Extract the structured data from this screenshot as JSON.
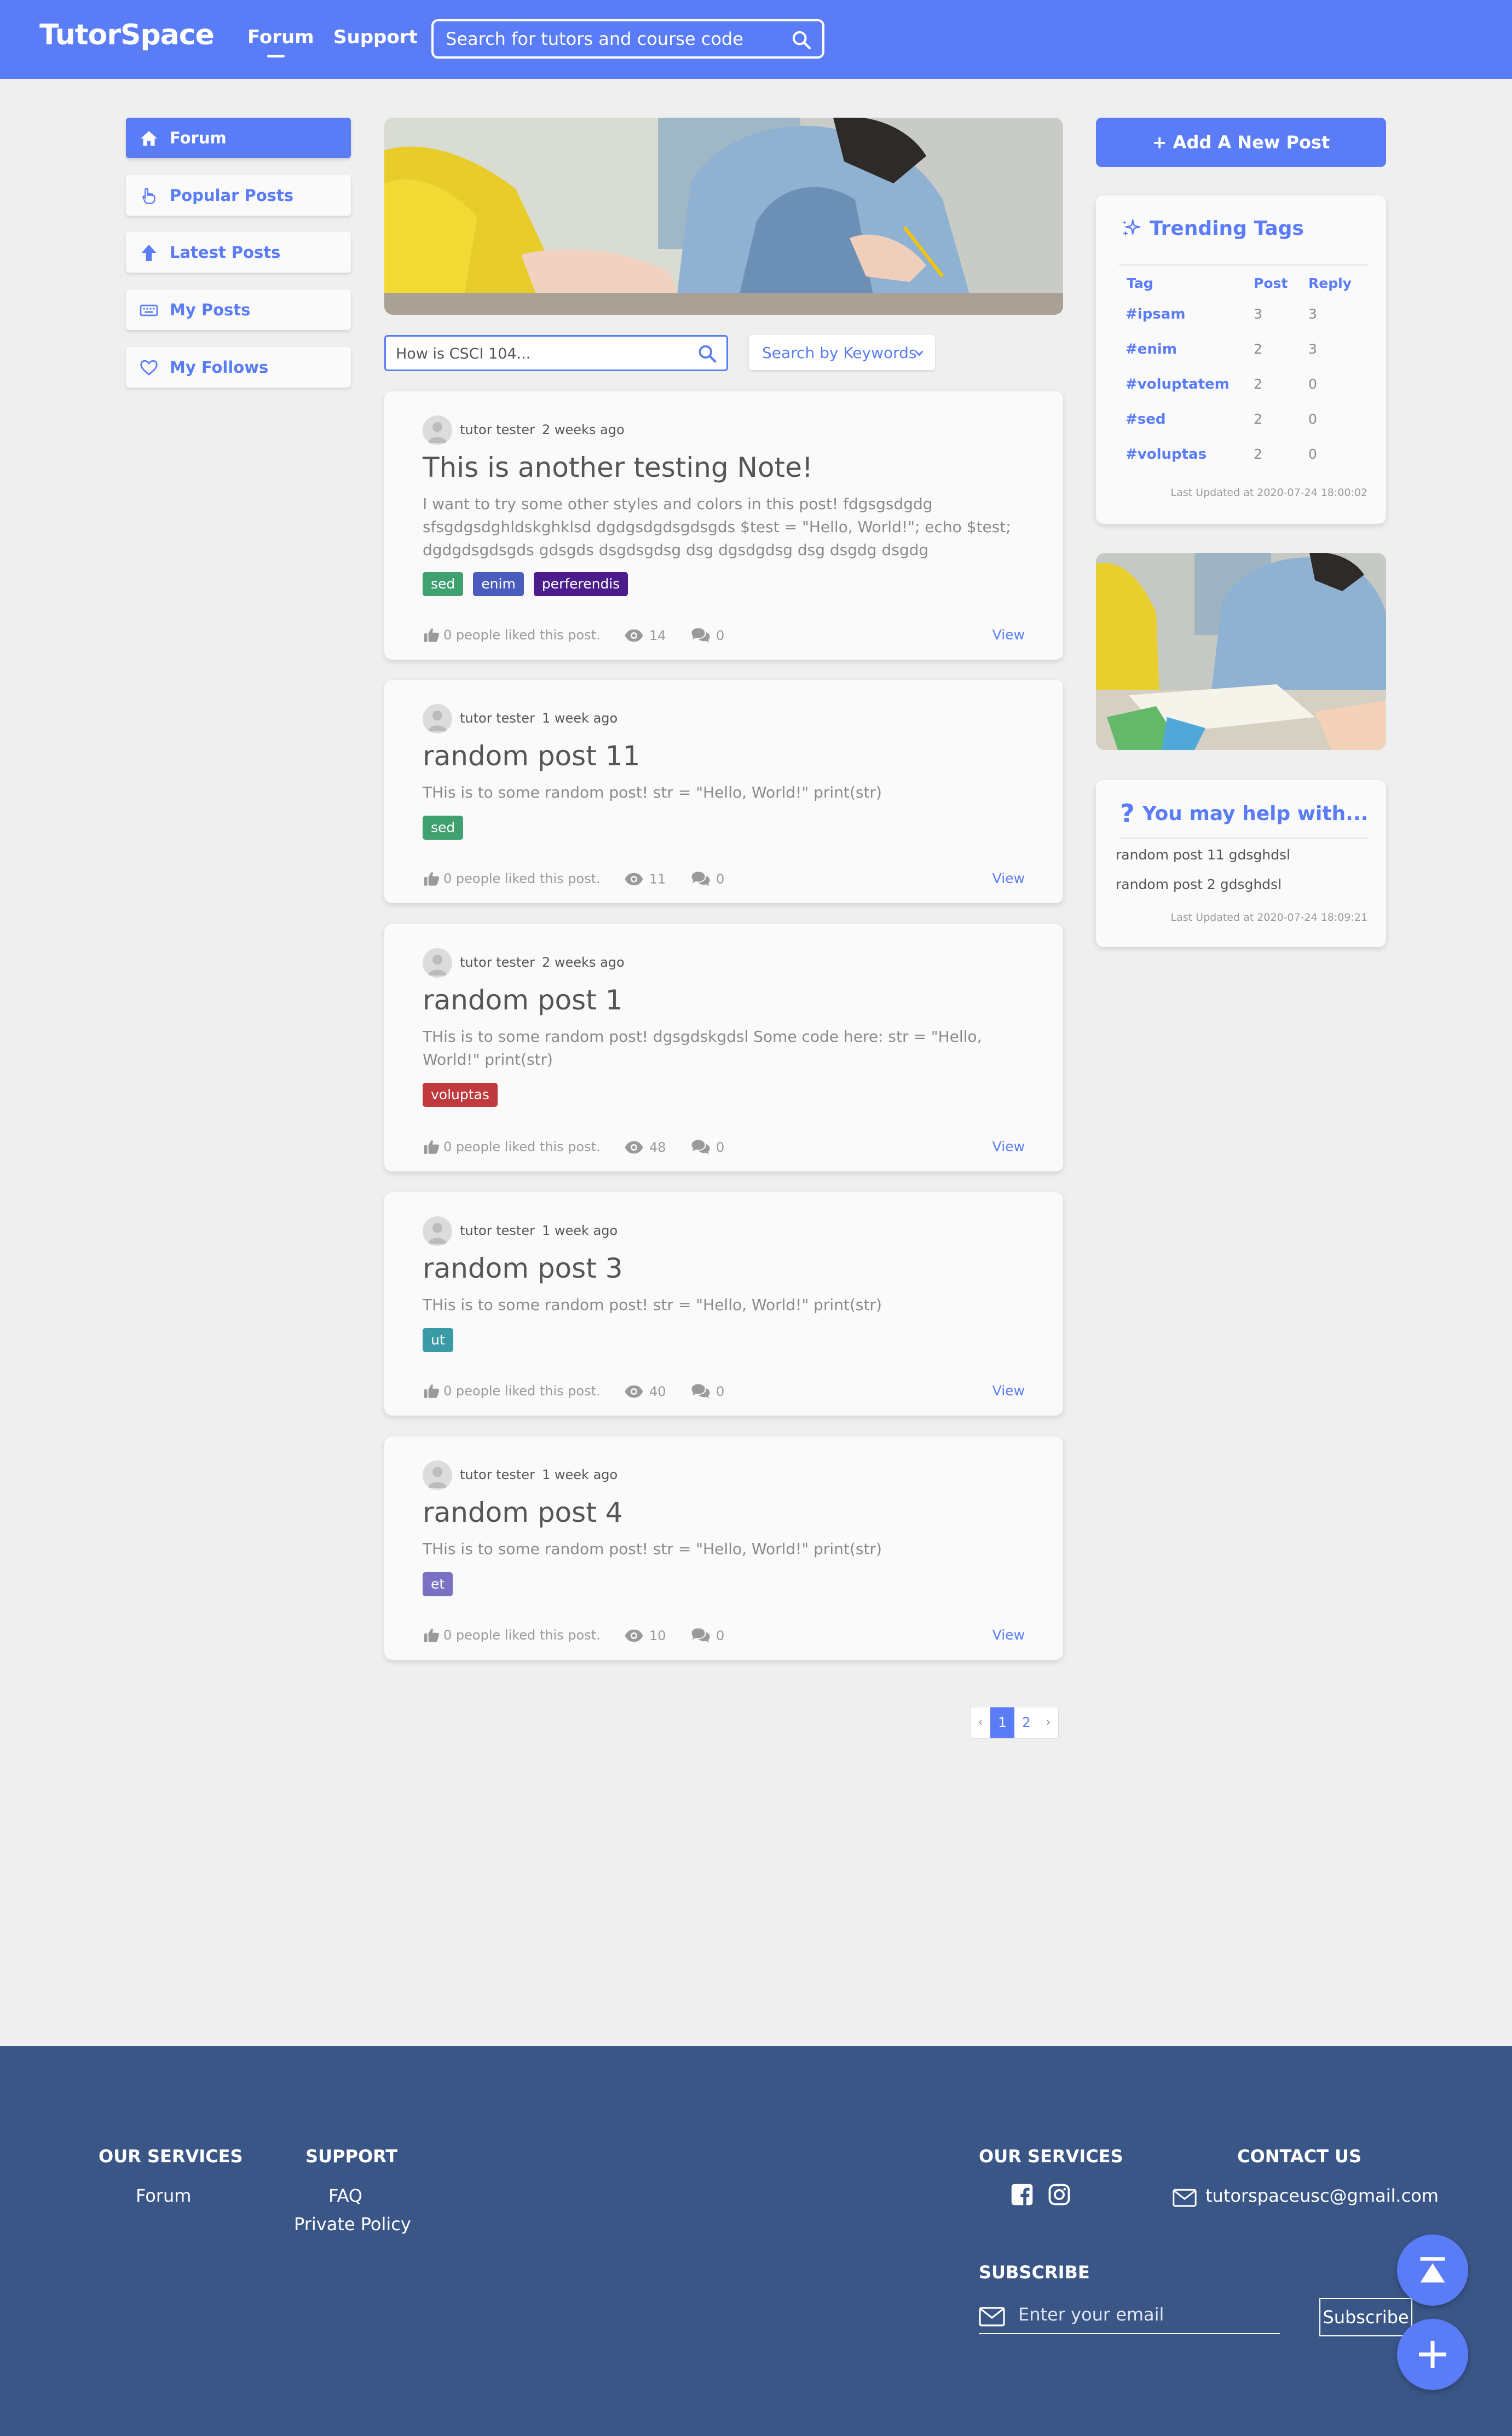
{
  "header": {
    "logo": "TutorSpace",
    "nav": [
      "Forum",
      "Support"
    ],
    "search_placeholder": "Search for tutors and course code"
  },
  "sidebar": {
    "items": [
      {
        "label": "Forum",
        "icon": "home-icon",
        "active": true
      },
      {
        "label": "Popular Posts",
        "icon": "hand-pointer-icon",
        "active": false
      },
      {
        "label": "Latest Posts",
        "icon": "arrow-up-icon",
        "active": false
      },
      {
        "label": "My Posts",
        "icon": "keyboard-icon",
        "active": false
      },
      {
        "label": "My Follows",
        "icon": "heart-icon",
        "active": false
      }
    ]
  },
  "feed": {
    "search_placeholder": "How is CSCI 104...",
    "filter_label": "Search by Keywords",
    "posts": [
      {
        "author": "tutor tester",
        "time": "2 weeks ago",
        "title": "This is another testing Note!",
        "body": "I want to try some other styles and colors in this post! fdgsgsdgdg sfsgdgsdghldskghklsd dgdgsdgdsgdsgds $test = \"Hello, World!\"; echo $test; dgdgdsgdsgds gdsgds dsgdsgdsg dsg dgsdgdsg dsg dsgdg dsgdg",
        "tags": [
          {
            "label": "sed",
            "color": "#3fa070"
          },
          {
            "label": "enim",
            "color": "#4b5cbf"
          },
          {
            "label": "perferendis",
            "color": "#4b1c8c"
          }
        ],
        "likes": "0 people liked this post.",
        "views": "14",
        "comments": "0",
        "view_label": "View"
      },
      {
        "author": "tutor tester",
        "time": "1 week ago",
        "title": "random post 11",
        "body": "THis is to some random post! str = \"Hello, World!\" print(str)",
        "tags": [
          {
            "label": "sed",
            "color": "#3fa070"
          }
        ],
        "likes": "0 people liked this post.",
        "views": "11",
        "comments": "0",
        "view_label": "View"
      },
      {
        "author": "tutor tester",
        "time": "2 weeks ago",
        "title": "random post 1",
        "body": "THis is to some random post! dgsgdskgdsl Some code here: str = \"Hello, World!\" print(str)",
        "tags": [
          {
            "label": "voluptas",
            "color": "#c0393d"
          }
        ],
        "likes": "0 people liked this post.",
        "views": "48",
        "comments": "0",
        "view_label": "View"
      },
      {
        "author": "tutor tester",
        "time": "1 week ago",
        "title": "random post 3",
        "body": "THis is to some random post! str = \"Hello, World!\" print(str)",
        "tags": [
          {
            "label": "ut",
            "color": "#3a9ba6"
          }
        ],
        "likes": "0 people liked this post.",
        "views": "40",
        "comments": "0",
        "view_label": "View"
      },
      {
        "author": "tutor tester",
        "time": "1 week ago",
        "title": "random post 4",
        "body": "THis is to some random post! str = \"Hello, World!\" print(str)",
        "tags": [
          {
            "label": "et",
            "color": "#7a70c4"
          }
        ],
        "likes": "0 people liked this post.",
        "views": "10",
        "comments": "0",
        "view_label": "View"
      }
    ],
    "pagination": {
      "prev": "‹",
      "pages": [
        "1",
        "2"
      ],
      "current": "1",
      "next": "›"
    }
  },
  "right": {
    "add_post": "+ Add A New Post",
    "trending": {
      "title": "Trending Tags",
      "headers": [
        "Tag",
        "Post",
        "Reply"
      ],
      "rows": [
        {
          "tag": "#ipsam",
          "post": "3",
          "reply": "3"
        },
        {
          "tag": "#enim",
          "post": "2",
          "reply": "3"
        },
        {
          "tag": "#voluptatem",
          "post": "2",
          "reply": "0"
        },
        {
          "tag": "#sed",
          "post": "2",
          "reply": "0"
        },
        {
          "tag": "#voluptas",
          "post": "2",
          "reply": "0"
        }
      ],
      "updated": "Last Updated at 2020-07-24 18:00:02"
    },
    "help": {
      "title": "You may help with...",
      "items": [
        "random post 11 gdsghdsl",
        "random post 2 gdsghdsl"
      ],
      "updated": "Last Updated at 2020-07-24 18:09:21"
    }
  },
  "footer": {
    "col1_title": "OUR SERVICES",
    "col1_links": [
      "Forum"
    ],
    "col2_title": "SUPPORT",
    "col2_links": [
      "FAQ",
      "Private Policy"
    ],
    "col3_title": "OUR SERVICES",
    "col4_title": "CONTACT US",
    "email": "tutorspaceusc@gmail.com",
    "subscribe_title": "SUBSCRIBE",
    "subscribe_placeholder": "Enter your email",
    "subscribe_button": "Subscribe"
  },
  "colors": {
    "accent": "#5a7cf7",
    "footer": "#3a5687",
    "background": "#efefef"
  }
}
